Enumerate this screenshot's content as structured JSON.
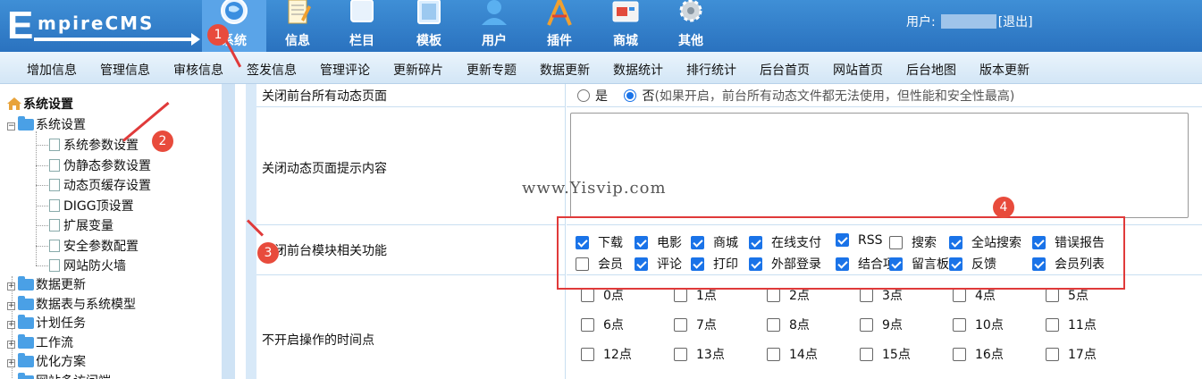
{
  "logo": {
    "big_letter": "E",
    "rest": "mpireCMS"
  },
  "nav": [
    {
      "label": "系统",
      "icon": "globe-icon",
      "active": true
    },
    {
      "label": "信息",
      "icon": "notepad-icon"
    },
    {
      "label": "栏目",
      "icon": "window-icon"
    },
    {
      "label": "模板",
      "icon": "template-icon"
    },
    {
      "label": "用户",
      "icon": "user-icon"
    },
    {
      "label": "插件",
      "icon": "compass-icon"
    },
    {
      "label": "商城",
      "icon": "shop-icon"
    },
    {
      "label": "其他",
      "icon": "gear-icon"
    }
  ],
  "userbar": {
    "prefix": "用户:",
    "logout": "[退出]"
  },
  "submenu": [
    "增加信息",
    "管理信息",
    "审核信息",
    "签发信息",
    "管理评论",
    "更新碎片",
    "更新专题",
    "数据更新",
    "数据统计",
    "排行统计",
    "后台首页",
    "网站首页",
    "后台地图",
    "版本更新"
  ],
  "sidebar": {
    "root": "系统设置",
    "group": "系统设置",
    "children": [
      "系统参数设置",
      "伪静态参数设置",
      "动态页缓存设置",
      "DIGG顶设置",
      "扩展变量",
      "安全参数配置",
      "网站防火墙"
    ],
    "collapsed": [
      "数据更新",
      "数据表与系统模型",
      "计划任务",
      "工作流",
      "优化方案",
      "网站多访问端"
    ]
  },
  "form": {
    "row1": {
      "label": "关闭前台所有动态页面",
      "yes": "是",
      "no": "否",
      "hint": "(如果开启，前台所有动态文件都无法使用，但性能和安全性最高)"
    },
    "row2": {
      "label": "关闭动态页面提示内容",
      "value": ""
    },
    "row3": {
      "label": "关闭前台模块相关功能",
      "options": [
        {
          "label": "下载",
          "checked": true
        },
        {
          "label": "电影",
          "checked": true
        },
        {
          "label": "商城",
          "checked": true
        },
        {
          "label": "在线支付",
          "checked": true
        },
        {
          "label": "RSS",
          "checked": true
        },
        {
          "label": "搜索",
          "checked": false
        },
        {
          "label": "全站搜索",
          "checked": true
        },
        {
          "label": "错误报告",
          "checked": true
        },
        {
          "label": "会员",
          "checked": false
        },
        {
          "label": "评论",
          "checked": true
        },
        {
          "label": "打印",
          "checked": true
        },
        {
          "label": "外部登录",
          "checked": true
        },
        {
          "label": "结合项",
          "checked": true
        },
        {
          "label": "留言板",
          "checked": true
        },
        {
          "label": "反馈",
          "checked": true
        },
        {
          "label": "会员列表",
          "checked": true
        }
      ]
    },
    "row4": {
      "label": "不开启操作的时间点",
      "hours": [
        "0点",
        "1点",
        "2点",
        "3点",
        "4点",
        "5点",
        "6点",
        "7点",
        "8点",
        "9点",
        "10点",
        "11点",
        "12点",
        "13点",
        "14点",
        "15点",
        "16点",
        "17点"
      ]
    }
  },
  "annotations": [
    "1",
    "2",
    "3",
    "4"
  ],
  "watermark": "www.Yisvip.com",
  "colors": {
    "header": "#2a72bf",
    "accent": "#1a73e8",
    "annotation": "#e03a3a"
  }
}
